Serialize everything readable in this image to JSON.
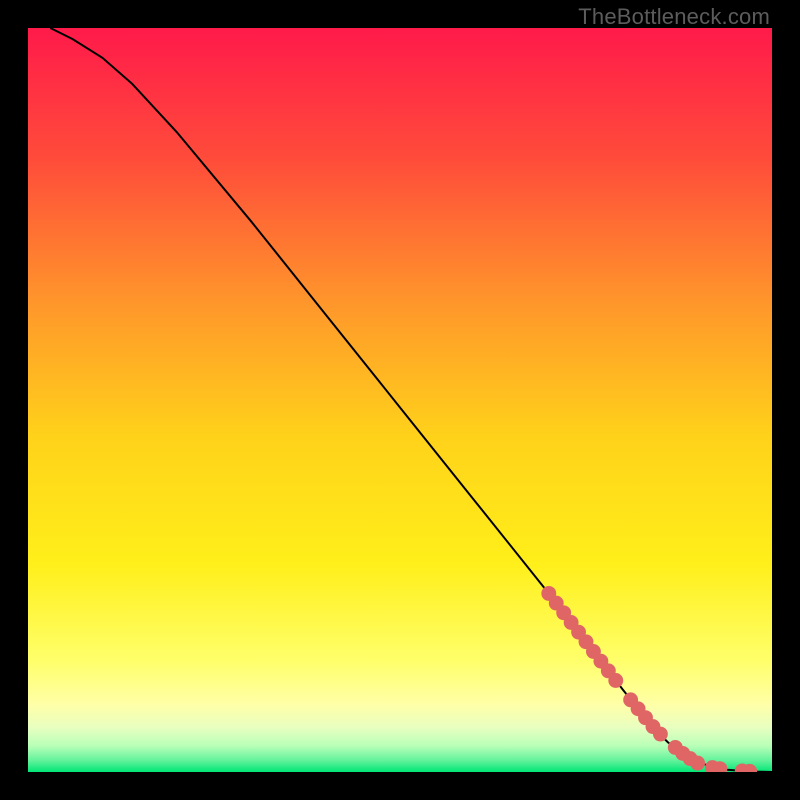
{
  "watermark": "TheBottleneck.com",
  "colors": {
    "top": "#ff1a4a",
    "upper_mid": "#ff7a2e",
    "mid": "#ffe31a",
    "lower_mid": "#ffff7a",
    "pale": "#d8ffb0",
    "bottom": "#00e676",
    "curve": "#000000",
    "marker": "#e06666",
    "frame": "#000000"
  },
  "chart_data": {
    "type": "line",
    "title": "",
    "xlabel": "",
    "ylabel": "",
    "xlim": [
      0,
      100
    ],
    "ylim": [
      0,
      100
    ],
    "series": [
      {
        "name": "bottleneck-curve",
        "x": [
          3,
          6,
          10,
          14,
          20,
          30,
          40,
          50,
          60,
          70,
          75,
          80,
          84,
          86,
          88,
          90,
          92,
          94,
          96,
          98,
          100
        ],
        "y": [
          100,
          98.5,
          96,
          92.5,
          86,
          74,
          61.5,
          49,
          36.5,
          24,
          17.5,
          11,
          6,
          4,
          2.5,
          1.3,
          0.7,
          0.3,
          0.15,
          0.05,
          0
        ]
      }
    ],
    "markers": {
      "name": "highlighted-points",
      "x": [
        70,
        71,
        72,
        73,
        74,
        75,
        76,
        77,
        78,
        79,
        81,
        82,
        83,
        84,
        85,
        87,
        88,
        89,
        90,
        92,
        93,
        96,
        97
      ],
      "y": [
        24,
        22.7,
        21.4,
        20.1,
        18.8,
        17.5,
        16.2,
        14.9,
        13.6,
        12.3,
        9.7,
        8.5,
        7.3,
        6.1,
        5.1,
        3.3,
        2.5,
        1.8,
        1.2,
        0.6,
        0.45,
        0.15,
        0.1
      ]
    }
  }
}
